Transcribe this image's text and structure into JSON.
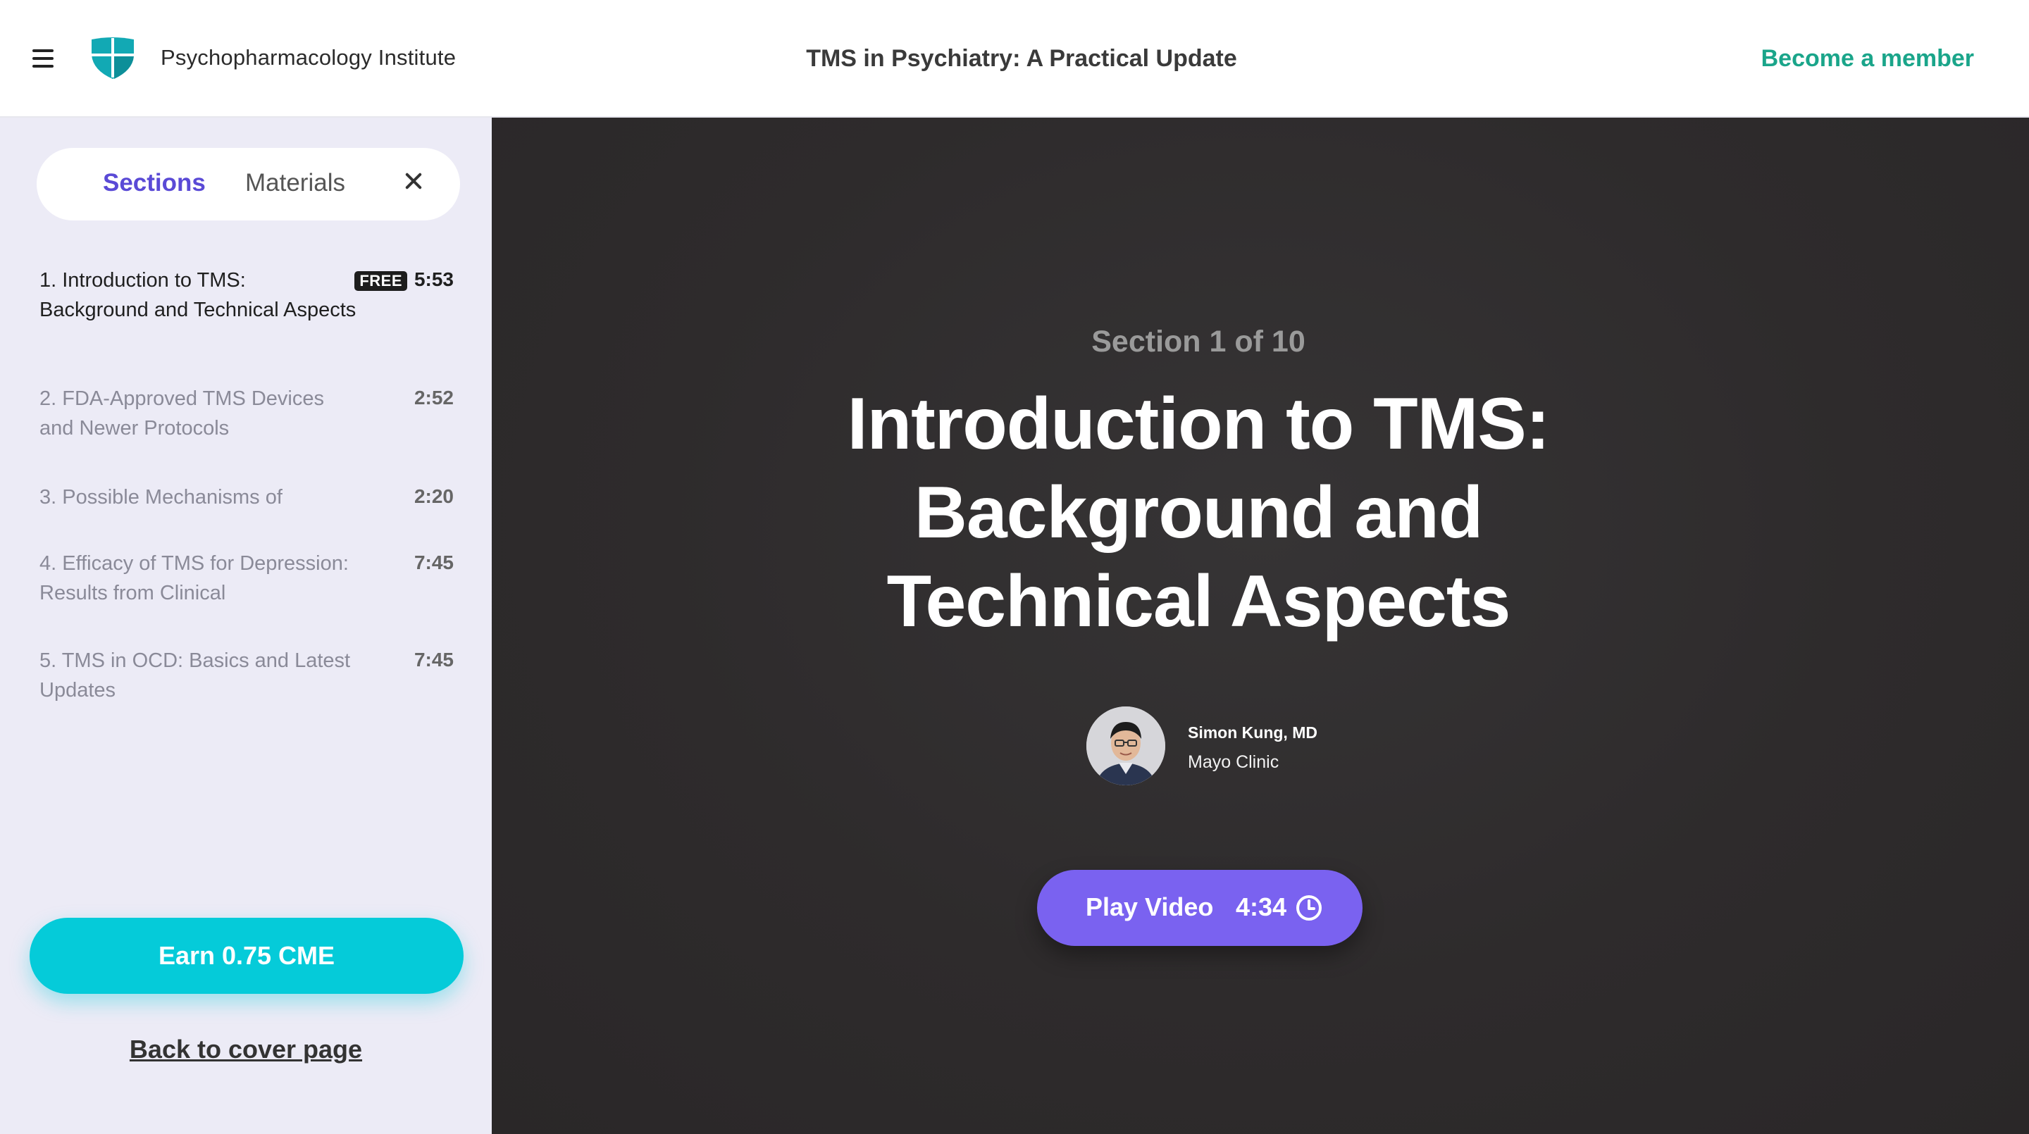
{
  "header": {
    "brand": "Psychopharmacology Institute",
    "course_title": "TMS in Psychiatry: A Practical Update",
    "member_link": "Become a member",
    "menu_icon": "hamburger-icon",
    "logo_icon": "shield-logo"
  },
  "sidebar": {
    "tabs": {
      "sections": "Sections",
      "materials": "Materials"
    },
    "close_icon": "close-icon",
    "sections": [
      {
        "title": "1. Introduction to TMS: Background and Technical Aspects",
        "badge": "FREE",
        "duration": "5:53",
        "current": true
      },
      {
        "title": "2. FDA-Approved TMS Devices and Newer Protocols",
        "duration": "2:52"
      },
      {
        "title": "3. Possible Mechanisms of",
        "duration": "2:20"
      },
      {
        "title": "4. Efficacy of TMS for Depression: Results from Clinical",
        "duration": "7:45"
      },
      {
        "title": "5. TMS in OCD: Basics and Latest Updates",
        "duration": "7:45"
      }
    ],
    "cme_button": "Earn 0.75 CME",
    "back_link": "Back to cover page"
  },
  "main": {
    "section_count": "Section 1 of 10",
    "heading_lines": [
      "Introduction to TMS:",
      "Background and",
      "Technical Aspects"
    ],
    "presenter": {
      "name": "Simon Kung, MD",
      "organization": "Mayo Clinic"
    },
    "play": {
      "label": "Play Video",
      "time": "4:34",
      "icon": "clock-icon"
    }
  },
  "colors": {
    "accent_purple": "#5a4ad6",
    "play_button": "#7a62f0",
    "cme_cyan": "#05cbd9",
    "member_green": "#1aa58a",
    "stage_dark": "#2e2b2c",
    "sidebar_bg": "#ecebf6"
  }
}
